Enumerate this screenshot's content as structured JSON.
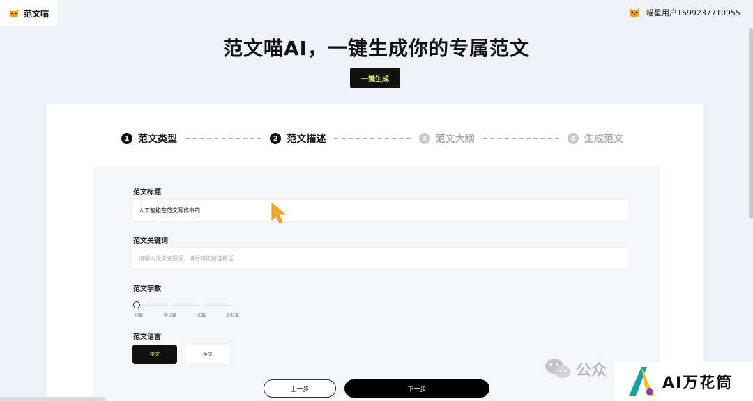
{
  "brand": {
    "name": "范文喵",
    "icon": "cat-icon"
  },
  "user": {
    "name": "喵星用户1699237710955",
    "icon": "cat-avatar-icon"
  },
  "hero": {
    "title": "范文喵AI，一键生成你的专属范文",
    "button": "一键生成"
  },
  "steps": [
    {
      "num": "1",
      "label": "范文类型",
      "state": "done"
    },
    {
      "num": "2",
      "label": "范文描述",
      "state": "current"
    },
    {
      "num": "3",
      "label": "范文大纲",
      "state": "inactive"
    },
    {
      "num": "4",
      "label": "生成范文",
      "state": "inactive"
    }
  ],
  "form": {
    "title_label": "范文标题",
    "title_value": "人工智能在范文写作中的",
    "keywords_label": "范文关键词",
    "keywords_placeholder": "请输入论文关键词，请尽可能精准概括",
    "wordcount_label": "范文字数",
    "wordcount_options": [
      "短篇",
      "中长篇",
      "长篇",
      "超长篇"
    ],
    "wordcount_selected_index": 0,
    "language_label": "范文语言",
    "language_options": [
      "中文",
      "英文"
    ],
    "language_selected": "中文"
  },
  "nav": {
    "prev": "上一步",
    "next": "下一步"
  },
  "watermarks": {
    "wechat_text": "公众",
    "ai_text": "AI万花筒"
  },
  "colors": {
    "accent_yellow": "#e8f56a",
    "dark": "#111111",
    "bg": "#eef1f5"
  }
}
